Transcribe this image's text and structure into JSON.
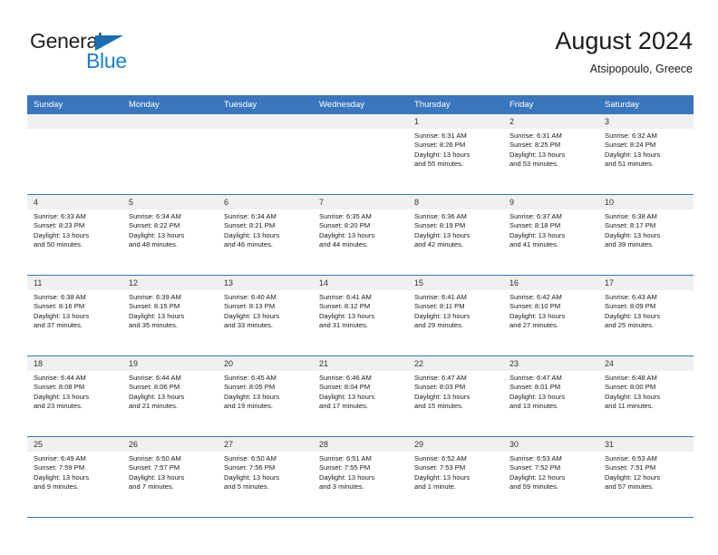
{
  "logo": {
    "word_one": "General",
    "word_two": "Blue",
    "triangle_color": "#1a6fb4",
    "blue_color": "#1a7fd4"
  },
  "header": {
    "title": "August 2024",
    "subtitle": "Atsipopoulo, Greece"
  },
  "theme": {
    "header_bar": "#3a76bd",
    "date_strip": "#f0f0f0",
    "text": "#1a1a1a"
  },
  "calendar": {
    "day_headers": [
      "Sunday",
      "Monday",
      "Tuesday",
      "Wednesday",
      "Thursday",
      "Friday",
      "Saturday"
    ],
    "weeks": [
      [
        {
          "date": "",
          "empty": true
        },
        {
          "date": "",
          "empty": true
        },
        {
          "date": "",
          "empty": true
        },
        {
          "date": "",
          "empty": true
        },
        {
          "date": "1",
          "sunrise": "Sunrise: 6:31 AM",
          "sunset": "Sunset: 8:26 PM",
          "daylight_1": "Daylight: 13 hours",
          "daylight_2": "and 55 minutes."
        },
        {
          "date": "2",
          "sunrise": "Sunrise: 6:31 AM",
          "sunset": "Sunset: 8:25 PM",
          "daylight_1": "Daylight: 13 hours",
          "daylight_2": "and 53 minutes."
        },
        {
          "date": "3",
          "sunrise": "Sunrise: 6:32 AM",
          "sunset": "Sunset: 8:24 PM",
          "daylight_1": "Daylight: 13 hours",
          "daylight_2": "and 51 minutes."
        }
      ],
      [
        {
          "date": "4",
          "sunrise": "Sunrise: 6:33 AM",
          "sunset": "Sunset: 8:23 PM",
          "daylight_1": "Daylight: 13 hours",
          "daylight_2": "and 50 minutes."
        },
        {
          "date": "5",
          "sunrise": "Sunrise: 6:34 AM",
          "sunset": "Sunset: 8:22 PM",
          "daylight_1": "Daylight: 13 hours",
          "daylight_2": "and 48 minutes."
        },
        {
          "date": "6",
          "sunrise": "Sunrise: 6:34 AM",
          "sunset": "Sunset: 8:21 PM",
          "daylight_1": "Daylight: 13 hours",
          "daylight_2": "and 46 minutes."
        },
        {
          "date": "7",
          "sunrise": "Sunrise: 6:35 AM",
          "sunset": "Sunset: 8:20 PM",
          "daylight_1": "Daylight: 13 hours",
          "daylight_2": "and 44 minutes."
        },
        {
          "date": "8",
          "sunrise": "Sunrise: 6:36 AM",
          "sunset": "Sunset: 8:19 PM",
          "daylight_1": "Daylight: 13 hours",
          "daylight_2": "and 42 minutes."
        },
        {
          "date": "9",
          "sunrise": "Sunrise: 6:37 AM",
          "sunset": "Sunset: 8:18 PM",
          "daylight_1": "Daylight: 13 hours",
          "daylight_2": "and 41 minutes."
        },
        {
          "date": "10",
          "sunrise": "Sunrise: 6:38 AM",
          "sunset": "Sunset: 8:17 PM",
          "daylight_1": "Daylight: 13 hours",
          "daylight_2": "and 39 minutes."
        }
      ],
      [
        {
          "date": "11",
          "sunrise": "Sunrise: 6:38 AM",
          "sunset": "Sunset: 8:16 PM",
          "daylight_1": "Daylight: 13 hours",
          "daylight_2": "and 37 minutes."
        },
        {
          "date": "12",
          "sunrise": "Sunrise: 6:39 AM",
          "sunset": "Sunset: 8:15 PM",
          "daylight_1": "Daylight: 13 hours",
          "daylight_2": "and 35 minutes."
        },
        {
          "date": "13",
          "sunrise": "Sunrise: 6:40 AM",
          "sunset": "Sunset: 8:13 PM",
          "daylight_1": "Daylight: 13 hours",
          "daylight_2": "and 33 minutes."
        },
        {
          "date": "14",
          "sunrise": "Sunrise: 6:41 AM",
          "sunset": "Sunset: 8:12 PM",
          "daylight_1": "Daylight: 13 hours",
          "daylight_2": "and 31 minutes."
        },
        {
          "date": "15",
          "sunrise": "Sunrise: 6:41 AM",
          "sunset": "Sunset: 8:11 PM",
          "daylight_1": "Daylight: 13 hours",
          "daylight_2": "and 29 minutes."
        },
        {
          "date": "16",
          "sunrise": "Sunrise: 6:42 AM",
          "sunset": "Sunset: 8:10 PM",
          "daylight_1": "Daylight: 13 hours",
          "daylight_2": "and 27 minutes."
        },
        {
          "date": "17",
          "sunrise": "Sunrise: 6:43 AM",
          "sunset": "Sunset: 8:09 PM",
          "daylight_1": "Daylight: 13 hours",
          "daylight_2": "and 25 minutes."
        }
      ],
      [
        {
          "date": "18",
          "sunrise": "Sunrise: 6:44 AM",
          "sunset": "Sunset: 8:08 PM",
          "daylight_1": "Daylight: 13 hours",
          "daylight_2": "and 23 minutes."
        },
        {
          "date": "19",
          "sunrise": "Sunrise: 6:44 AM",
          "sunset": "Sunset: 8:06 PM",
          "daylight_1": "Daylight: 13 hours",
          "daylight_2": "and 21 minutes."
        },
        {
          "date": "20",
          "sunrise": "Sunrise: 6:45 AM",
          "sunset": "Sunset: 8:05 PM",
          "daylight_1": "Daylight: 13 hours",
          "daylight_2": "and 19 minutes."
        },
        {
          "date": "21",
          "sunrise": "Sunrise: 6:46 AM",
          "sunset": "Sunset: 8:04 PM",
          "daylight_1": "Daylight: 13 hours",
          "daylight_2": "and 17 minutes."
        },
        {
          "date": "22",
          "sunrise": "Sunrise: 6:47 AM",
          "sunset": "Sunset: 8:03 PM",
          "daylight_1": "Daylight: 13 hours",
          "daylight_2": "and 15 minutes."
        },
        {
          "date": "23",
          "sunrise": "Sunrise: 6:47 AM",
          "sunset": "Sunset: 8:01 PM",
          "daylight_1": "Daylight: 13 hours",
          "daylight_2": "and 13 minutes."
        },
        {
          "date": "24",
          "sunrise": "Sunrise: 6:48 AM",
          "sunset": "Sunset: 8:00 PM",
          "daylight_1": "Daylight: 13 hours",
          "daylight_2": "and 11 minutes."
        }
      ],
      [
        {
          "date": "25",
          "sunrise": "Sunrise: 6:49 AM",
          "sunset": "Sunset: 7:59 PM",
          "daylight_1": "Daylight: 13 hours",
          "daylight_2": "and 9 minutes."
        },
        {
          "date": "26",
          "sunrise": "Sunrise: 6:50 AM",
          "sunset": "Sunset: 7:57 PM",
          "daylight_1": "Daylight: 13 hours",
          "daylight_2": "and 7 minutes."
        },
        {
          "date": "27",
          "sunrise": "Sunrise: 6:50 AM",
          "sunset": "Sunset: 7:56 PM",
          "daylight_1": "Daylight: 13 hours",
          "daylight_2": "and 5 minutes."
        },
        {
          "date": "28",
          "sunrise": "Sunrise: 6:51 AM",
          "sunset": "Sunset: 7:55 PM",
          "daylight_1": "Daylight: 13 hours",
          "daylight_2": "and 3 minutes."
        },
        {
          "date": "29",
          "sunrise": "Sunrise: 6:52 AM",
          "sunset": "Sunset: 7:53 PM",
          "daylight_1": "Daylight: 13 hours",
          "daylight_2": "and 1 minute."
        },
        {
          "date": "30",
          "sunrise": "Sunrise: 6:53 AM",
          "sunset": "Sunset: 7:52 PM",
          "daylight_1": "Daylight: 12 hours",
          "daylight_2": "and 59 minutes."
        },
        {
          "date": "31",
          "sunrise": "Sunrise: 6:53 AM",
          "sunset": "Sunset: 7:51 PM",
          "daylight_1": "Daylight: 12 hours",
          "daylight_2": "and 57 minutes."
        }
      ]
    ]
  }
}
